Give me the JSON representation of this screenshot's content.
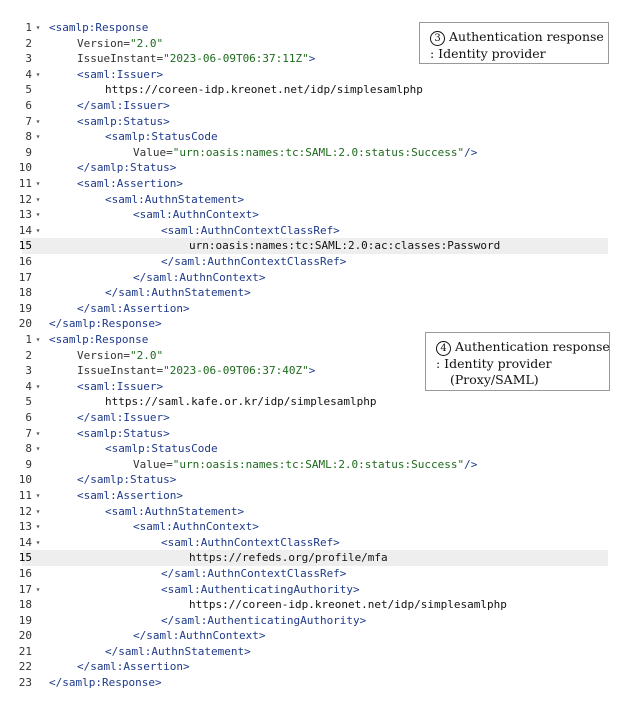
{
  "panels": [
    {
      "id": "panel1",
      "note": {
        "num": "3",
        "line1": "Authentication response",
        "line2": ": Identity provider",
        "line3": ""
      },
      "lines": [
        {
          "n": "1",
          "fold": true,
          "indent": 0,
          "parts": [
            [
              "tag",
              "<samlp:Response"
            ]
          ]
        },
        {
          "n": "2",
          "indent": 1,
          "parts": [
            [
              "attr",
              "Version="
            ],
            [
              "str",
              "\"2.0\""
            ]
          ]
        },
        {
          "n": "3",
          "indent": 1,
          "parts": [
            [
              "attr",
              "IssueInstant="
            ],
            [
              "str",
              "\"2023-06-09T06:37:11Z\""
            ],
            [
              "tag",
              ">"
            ]
          ]
        },
        {
          "n": "4",
          "fold": true,
          "indent": 1,
          "parts": [
            [
              "tag",
              "<saml:Issuer>"
            ]
          ]
        },
        {
          "n": "5",
          "indent": 2,
          "parts": [
            [
              "txt",
              "https://coreen-idp.kreonet.net/idp/simplesamlphp"
            ]
          ]
        },
        {
          "n": "6",
          "indent": 1,
          "parts": [
            [
              "tag",
              "</saml:Issuer>"
            ]
          ]
        },
        {
          "n": "7",
          "fold": true,
          "indent": 1,
          "parts": [
            [
              "tag",
              "<samlp:Status>"
            ]
          ]
        },
        {
          "n": "8",
          "fold": true,
          "indent": 2,
          "parts": [
            [
              "tag",
              "<samlp:StatusCode"
            ]
          ]
        },
        {
          "n": "9",
          "indent": 3,
          "parts": [
            [
              "attr",
              "Value="
            ],
            [
              "str",
              "\"urn:oasis:names:tc:SAML:2.0:status:Success\""
            ],
            [
              "tag",
              "/>"
            ]
          ]
        },
        {
          "n": "10",
          "indent": 1,
          "parts": [
            [
              "tag",
              "</samlp:Status>"
            ]
          ]
        },
        {
          "n": "11",
          "fold": true,
          "indent": 1,
          "parts": [
            [
              "tag",
              "<saml:Assertion>"
            ]
          ]
        },
        {
          "n": "12",
          "fold": true,
          "indent": 2,
          "parts": [
            [
              "tag",
              "<saml:AuthnStatement>"
            ]
          ]
        },
        {
          "n": "13",
          "fold": true,
          "indent": 3,
          "parts": [
            [
              "tag",
              "<saml:AuthnContext>"
            ]
          ]
        },
        {
          "n": "14",
          "fold": true,
          "indent": 4,
          "parts": [
            [
              "tag",
              "<saml:AuthnContextClassRef>"
            ]
          ]
        },
        {
          "n": "15",
          "hl": true,
          "indent": 5,
          "parts": [
            [
              "txt",
              "urn:oasis:names:tc:SAML:2.0:ac:classes:Password"
            ]
          ]
        },
        {
          "n": "16",
          "indent": 4,
          "parts": [
            [
              "tag",
              "</saml:AuthnContextClassRef>"
            ]
          ]
        },
        {
          "n": "17",
          "indent": 3,
          "parts": [
            [
              "tag",
              "</saml:AuthnContext>"
            ]
          ]
        },
        {
          "n": "18",
          "indent": 2,
          "parts": [
            [
              "tag",
              "</saml:AuthnStatement>"
            ]
          ]
        },
        {
          "n": "19",
          "indent": 1,
          "parts": [
            [
              "tag",
              "</saml:Assertion>"
            ]
          ]
        },
        {
          "n": "20",
          "indent": 0,
          "parts": [
            [
              "tag",
              "</samlp:Response>"
            ]
          ]
        }
      ]
    },
    {
      "id": "panel2",
      "note": {
        "num": "4",
        "line1": "Authentication response",
        "line2": ": Identity provider",
        "line3": "(Proxy/SAML)"
      },
      "lines": [
        {
          "n": "1",
          "fold": true,
          "indent": 0,
          "parts": [
            [
              "tag",
              "<samlp:Response"
            ]
          ]
        },
        {
          "n": "2",
          "indent": 1,
          "parts": [
            [
              "attr",
              "Version="
            ],
            [
              "str",
              "\"2.0\""
            ]
          ]
        },
        {
          "n": "3",
          "indent": 1,
          "parts": [
            [
              "attr",
              "IssueInstant="
            ],
            [
              "str",
              "\"2023-06-09T06:37:40Z\""
            ],
            [
              "tag",
              ">"
            ]
          ]
        },
        {
          "n": "4",
          "fold": true,
          "indent": 1,
          "parts": [
            [
              "tag",
              "<saml:Issuer>"
            ]
          ]
        },
        {
          "n": "5",
          "indent": 2,
          "parts": [
            [
              "txt",
              "https://saml.kafe.or.kr/idp/simplesamlphp"
            ]
          ]
        },
        {
          "n": "6",
          "indent": 1,
          "parts": [
            [
              "tag",
              "</saml:Issuer>"
            ]
          ]
        },
        {
          "n": "7",
          "fold": true,
          "indent": 1,
          "parts": [
            [
              "tag",
              "<samlp:Status>"
            ]
          ]
        },
        {
          "n": "8",
          "fold": true,
          "indent": 2,
          "parts": [
            [
              "tag",
              "<samlp:StatusCode"
            ]
          ]
        },
        {
          "n": "9",
          "indent": 3,
          "parts": [
            [
              "attr",
              "Value="
            ],
            [
              "str",
              "\"urn:oasis:names:tc:SAML:2.0:status:Success\""
            ],
            [
              "tag",
              "/>"
            ]
          ]
        },
        {
          "n": "10",
          "indent": 1,
          "parts": [
            [
              "tag",
              "</samlp:Status>"
            ]
          ]
        },
        {
          "n": "11",
          "fold": true,
          "indent": 1,
          "parts": [
            [
              "tag",
              "<saml:Assertion>"
            ]
          ]
        },
        {
          "n": "12",
          "fold": true,
          "indent": 2,
          "parts": [
            [
              "tag",
              "<saml:AuthnStatement>"
            ]
          ]
        },
        {
          "n": "13",
          "fold": true,
          "indent": 3,
          "parts": [
            [
              "tag",
              "<saml:AuthnContext>"
            ]
          ]
        },
        {
          "n": "14",
          "fold": true,
          "indent": 4,
          "parts": [
            [
              "tag",
              "<saml:AuthnContextClassRef>"
            ]
          ]
        },
        {
          "n": "15",
          "hl": true,
          "indent": 5,
          "parts": [
            [
              "txt",
              "https://refeds.org/profile/mfa"
            ]
          ]
        },
        {
          "n": "16",
          "indent": 4,
          "parts": [
            [
              "tag",
              "</saml:AuthnContextClassRef>"
            ]
          ]
        },
        {
          "n": "17",
          "fold": true,
          "indent": 4,
          "parts": [
            [
              "tag",
              "<saml:AuthenticatingAuthority>"
            ]
          ]
        },
        {
          "n": "18",
          "indent": 5,
          "parts": [
            [
              "txt",
              "https://coreen-idp.kreonet.net/idp/simplesamlphp"
            ]
          ]
        },
        {
          "n": "19",
          "indent": 4,
          "parts": [
            [
              "tag",
              "</saml:AuthenticatingAuthority>"
            ]
          ]
        },
        {
          "n": "20",
          "indent": 3,
          "parts": [
            [
              "tag",
              "</saml:AuthnContext>"
            ]
          ]
        },
        {
          "n": "21",
          "indent": 2,
          "parts": [
            [
              "tag",
              "</saml:AuthnStatement>"
            ]
          ]
        },
        {
          "n": "22",
          "indent": 1,
          "parts": [
            [
              "tag",
              "</saml:Assertion>"
            ]
          ]
        },
        {
          "n": "23",
          "indent": 0,
          "parts": [
            [
              "tag",
              "</samlp:Response>"
            ]
          ]
        }
      ]
    }
  ],
  "fold_glyph": "▾"
}
